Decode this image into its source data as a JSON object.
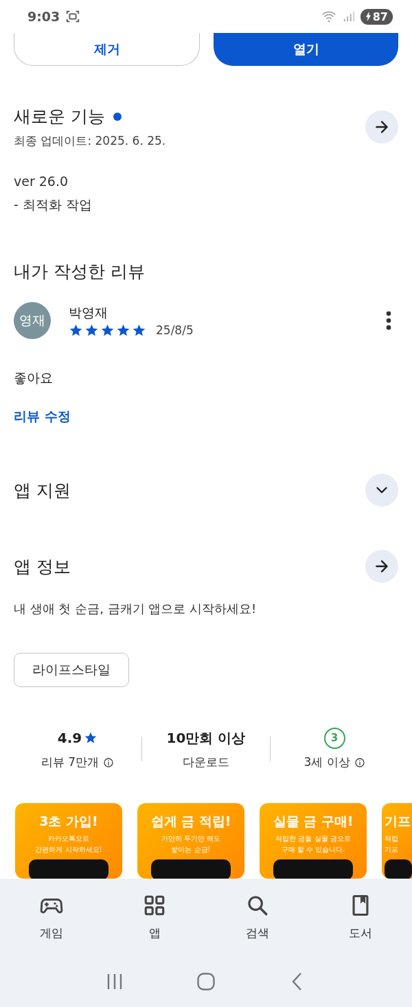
{
  "status_bar": {
    "time": "9:03",
    "battery": "87"
  },
  "actions": [
    {
      "label": "제거",
      "kind": "outline"
    },
    {
      "label": "열기",
      "kind": "filled"
    }
  ],
  "whats_new": {
    "title": "새로운 기능",
    "new": true,
    "updated": "최종 업데이트: 2025. 6. 25.",
    "notes": [
      "ver 26.0",
      "- 최적화 작업"
    ]
  },
  "my_review": {
    "title": "내가 작성한 리뷰",
    "author": "박영재",
    "avatar": "영재",
    "stars": 5,
    "date": "25/8/5",
    "text": "좋아요",
    "edit_link": "리뷰 수정"
  },
  "app_support": {
    "title": "앱 지원",
    "expanded": false
  },
  "app_info": {
    "title": "앱 정보",
    "description": "내 생애 첫 순금, 금캐기 앱으로 시작하세요!",
    "tag": "라이프스타일"
  },
  "stats": [
    {
      "kind": "rating",
      "value": "4.9",
      "label": "리뷰 7만개"
    },
    {
      "kind": "plain",
      "value": "10만회 이상",
      "label": "다운로드"
    },
    {
      "kind": "age",
      "value": "3",
      "label": "3세 이상"
    }
  ],
  "screenshots": [
    {
      "title": "3초 가입!",
      "lines": [
        "카카오톡으로",
        "간편하게 시작하세요!"
      ]
    },
    {
      "title": "쉽게 금 적립!",
      "lines": [
        "가만히 두기만 해도",
        "쌓이는 순금!"
      ]
    },
    {
      "title": "실물 금 구매!",
      "lines": [
        "적립한 금을 실물 금으로",
        "구매 할 수 있습니다."
      ]
    },
    {
      "title": "기프",
      "lines": [
        "적립",
        "기프"
      ]
    }
  ],
  "bottom_nav": [
    {
      "kind": "games",
      "label": "게임",
      "selected": false
    },
    {
      "kind": "apps",
      "label": "앱",
      "selected": false
    },
    {
      "kind": "search",
      "label": "검색",
      "selected": false
    },
    {
      "kind": "books",
      "label": "도서",
      "selected": false
    }
  ]
}
